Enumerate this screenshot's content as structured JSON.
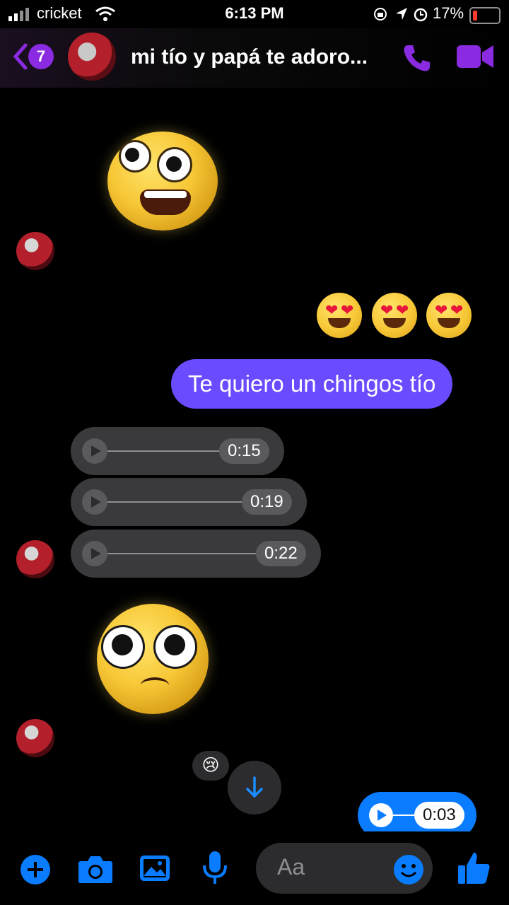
{
  "status_bar": {
    "carrier": "cricket",
    "time": "6:13 PM",
    "battery": "17%"
  },
  "header": {
    "unread_count": "7",
    "contact_name": "mi tío y papá te adoro..."
  },
  "messages": {
    "sent_text": "Te quiero un chingos tío",
    "voice_1": "0:15",
    "voice_2": "0:19",
    "voice_3": "0:22",
    "reaction": "😢",
    "sent_voice": "0:03"
  },
  "composer": {
    "placeholder": "Aa"
  },
  "colors": {
    "accent": "#8a2be2",
    "sent_bubble": "#6b4bff",
    "messenger_blue": "#0a7cff"
  }
}
